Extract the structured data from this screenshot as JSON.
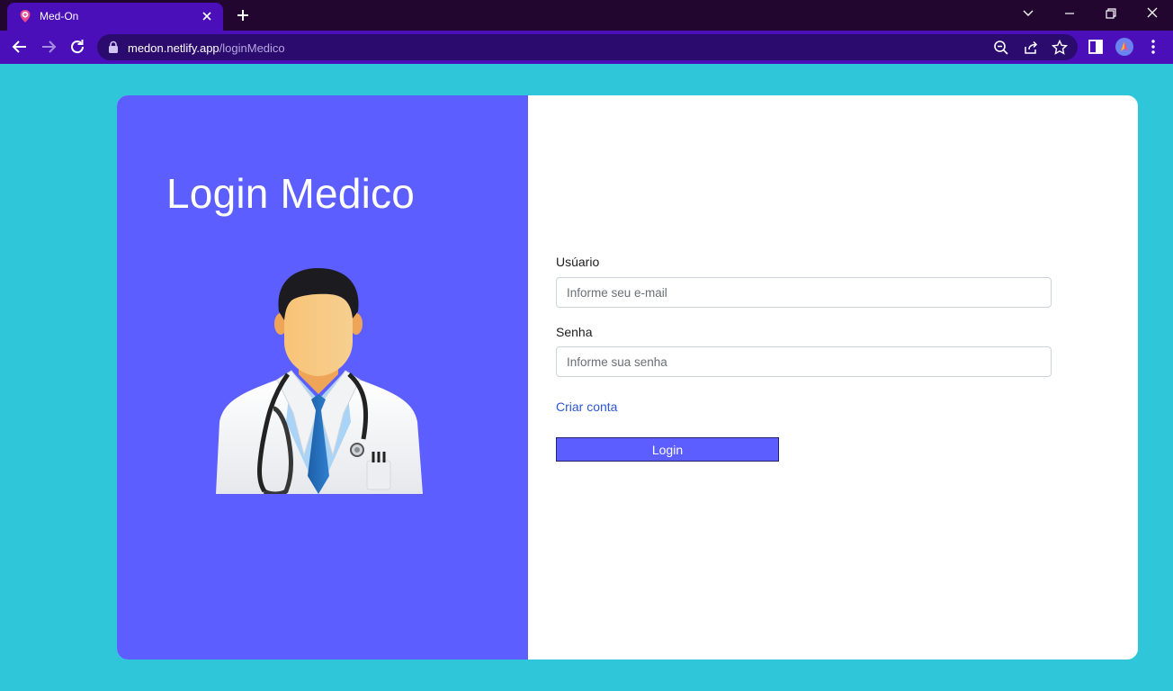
{
  "browser": {
    "tab_title": "Med-On",
    "url_domain": "medon.netlify.app",
    "url_path": "/loginMedico",
    "accent": "#4a0fb8",
    "titlebar_color": "#22062f"
  },
  "page": {
    "background": "#2fc6da",
    "title": "Login Medico",
    "illustration": "doctor-avatar",
    "panel_color": "#5c5eff"
  },
  "form": {
    "user_label": "Usúario",
    "user_placeholder": "Informe seu e-mail",
    "password_label": "Senha",
    "password_placeholder": "Informe sua senha",
    "create_account_link": "Criar conta",
    "login_button": "Login"
  }
}
